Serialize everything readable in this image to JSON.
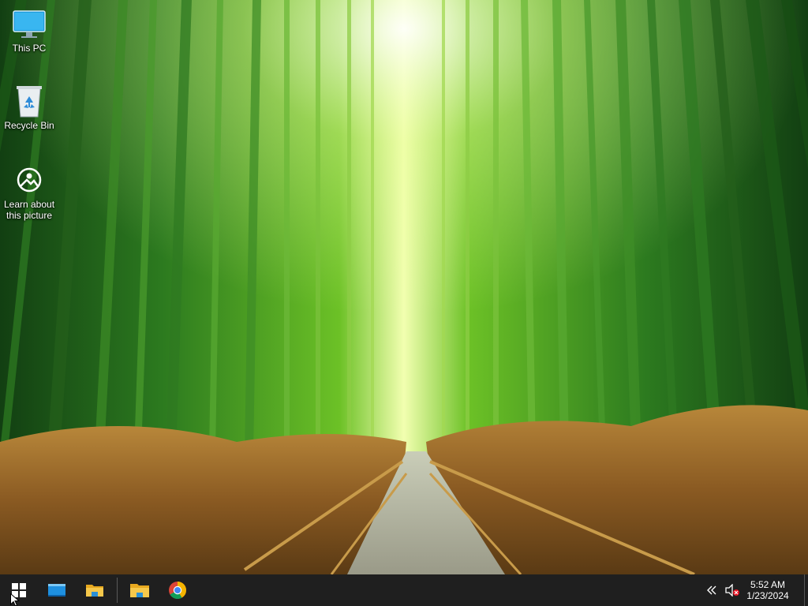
{
  "desktop": {
    "icons": [
      {
        "label": "This PC",
        "icon": "monitor-icon"
      },
      {
        "label": "Recycle Bin",
        "icon": "recycle-bin-icon"
      },
      {
        "label_line1": "Learn about",
        "label_line2": "this picture",
        "icon": "camera-icon"
      }
    ]
  },
  "taskbar": {
    "start": {
      "icon": "windows-logo-icon"
    },
    "pinned": [
      {
        "name": "desktop-app",
        "icon": "window-icon"
      },
      {
        "name": "file-explorer",
        "icon": "folder-icon"
      },
      {
        "name": "file-explorer-2",
        "icon": "folder-icon"
      },
      {
        "name": "chrome",
        "icon": "chrome-icon"
      }
    ],
    "tray": {
      "overflow_icon": "chevron-left-icon",
      "volume_icon": "speaker-muted-icon",
      "time": "5:52 AM",
      "date": "1/23/2024"
    }
  },
  "colors": {
    "taskbar_bg": "#1f1f1f",
    "windows_blue": "#00a4ef",
    "folder_yellow": "#f6c84b",
    "mute_red": "#e81123"
  }
}
